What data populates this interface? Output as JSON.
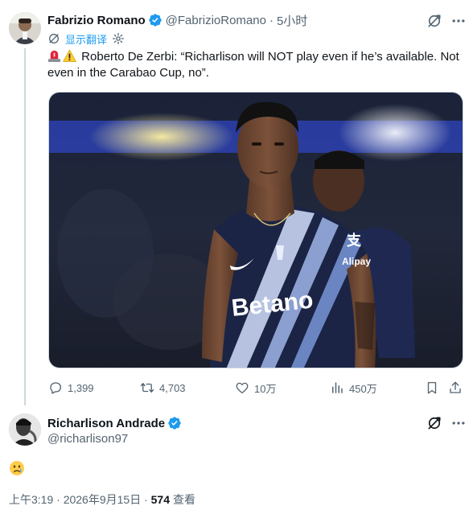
{
  "quoted": {
    "author_name": "Fabrizio Romano",
    "author_handle": "@FabrizioRomano",
    "separator": "·",
    "time_ago": "5小时",
    "translate_label": "显示翻译",
    "text": "Roberto De Zerbi: “Richarlison will NOT play even if he’s available. Not even in the Carabao Cup, no”.",
    "emojis": [
      "rotating-light-emoji",
      "warning-emoji"
    ],
    "image_jersey_text": "Betano",
    "image_sponsor_text": "Alipay",
    "image_sponsor_mark": "支",
    "actions": {
      "replies": "1,399",
      "reposts": "4,703",
      "likes": "10万",
      "views": "450万"
    }
  },
  "reply": {
    "author_name": "Richarlison Andrade",
    "author_handle": "@richarlison97",
    "emoji": "crying-face-emoji",
    "timestamp": "上午3:19 · 2026年9月15日 · ",
    "view_count": "574",
    "view_label": " 查看"
  },
  "colors": {
    "accent": "#1d9bf0",
    "verified": "#1d9bf0",
    "muted": "#536471",
    "text": "#0f1419",
    "border": "#cfd9de",
    "jersey": "#1b2444"
  }
}
